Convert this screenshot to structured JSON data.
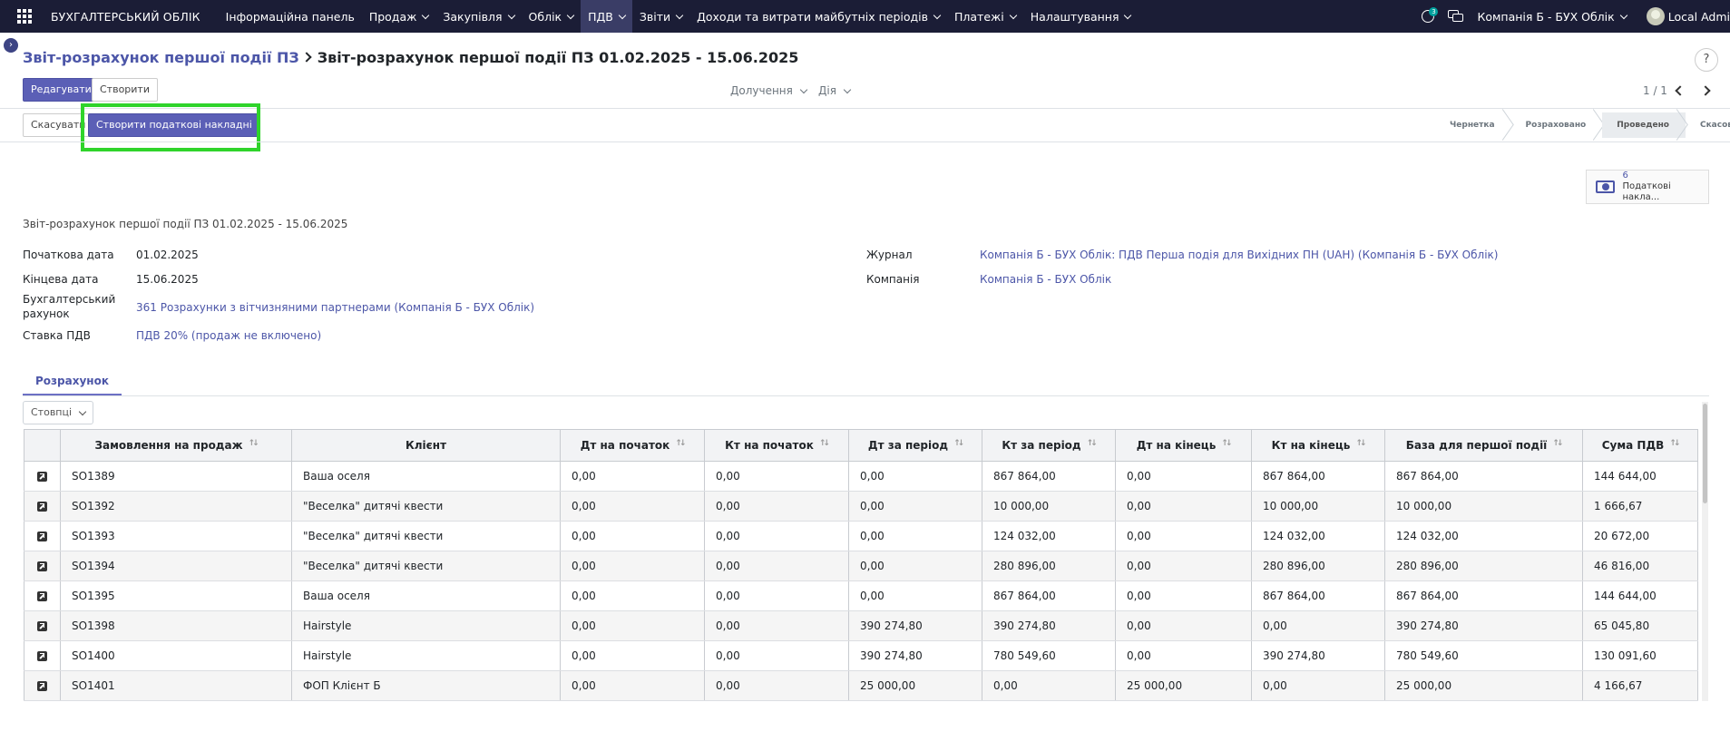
{
  "navbar": {
    "brand": "БУХГАЛТЕРСЬКИЙ ОБЛІК",
    "menu": [
      {
        "label": "Інформаційна панель",
        "dropdown": false,
        "active": false
      },
      {
        "label": "Продаж",
        "dropdown": true,
        "active": false
      },
      {
        "label": "Закупівля",
        "dropdown": true,
        "active": false
      },
      {
        "label": "Облік",
        "dropdown": true,
        "active": false
      },
      {
        "label": "ПДВ",
        "dropdown": true,
        "active": true
      },
      {
        "label": "Звіти",
        "dropdown": true,
        "active": false
      },
      {
        "label": "Доходи та витрати майбутніх періодів",
        "dropdown": true,
        "active": false
      },
      {
        "label": "Платежі",
        "dropdown": true,
        "active": false
      },
      {
        "label": "Налаштування",
        "dropdown": true,
        "active": false
      }
    ],
    "activity_badge": "3",
    "company": "Компанія Б - БУХ Облік",
    "user": "Local Admi"
  },
  "breadcrumb": {
    "parent": "Звіт-розрахунок першої події ПЗ",
    "current": "Звіт-розрахунок першої події ПЗ 01.02.2025 - 15.06.2025"
  },
  "help_label": "?",
  "control": {
    "edit_label": "Редагувати",
    "create_label": "Створити",
    "attachments_label": "Долучення",
    "action_label": "Дія",
    "pager": "1 / 1"
  },
  "statusbar": {
    "cancel_label": "Скасувати",
    "create_invoices_label": "Створити податкові накладні",
    "stages": [
      {
        "label": "Чернетка",
        "current": false
      },
      {
        "label": "Розраховано",
        "current": false
      },
      {
        "label": "Проведено",
        "current": true
      },
      {
        "label": "Скасовано",
        "current": false
      }
    ]
  },
  "smart_button": {
    "count": "6",
    "label": "Податкові накла..."
  },
  "form": {
    "title": "Звіт-розрахунок першої події ПЗ 01.02.2025 - 15.06.2025",
    "start_date_label": "Початкова дата",
    "start_date": "01.02.2025",
    "end_date_label": "Кінцева дата",
    "end_date": "15.06.2025",
    "account_label_1": "Бухгалтерський",
    "account_label_2": "рахунок",
    "account": "361 Розрахунки з вітчизняними партнерами (Компанія Б - БУХ Облік)",
    "vat_rate_label": "Ставка ПДВ",
    "vat_rate": "ПДВ 20% (продаж не включено)",
    "journal_label": "Журнал",
    "journal": "Компанія Б - БУХ Облік: ПДВ Перша подія для Вихідних ПН (UAH) (Компанія Б - БУХ Облік)",
    "company_label": "Компанія",
    "company": "Компанія Б - БУХ Облік"
  },
  "tab_label": "Розрахунок",
  "columns_button": "Стовпці",
  "table": {
    "headers": [
      "Замовлення на продаж",
      "Клієнт",
      "Дт на початок",
      "Кт на початок",
      "Дт за період",
      "Кт за період",
      "Дт на кінець",
      "Кт на кінець",
      "База для першої події",
      "Сума ПДВ"
    ],
    "rows": [
      [
        "SO1389",
        "Ваша оселя",
        "0,00",
        "0,00",
        "0,00",
        "867 864,00",
        "0,00",
        "867 864,00",
        "867 864,00",
        "144 644,00"
      ],
      [
        "SO1392",
        "\"Веселка\" дитячі квести",
        "0,00",
        "0,00",
        "0,00",
        "10 000,00",
        "0,00",
        "10 000,00",
        "10 000,00",
        "1 666,67"
      ],
      [
        "SO1393",
        "\"Веселка\" дитячі квести",
        "0,00",
        "0,00",
        "0,00",
        "124 032,00",
        "0,00",
        "124 032,00",
        "124 032,00",
        "20 672,00"
      ],
      [
        "SO1394",
        "\"Веселка\" дитячі квести",
        "0,00",
        "0,00",
        "0,00",
        "280 896,00",
        "0,00",
        "280 896,00",
        "280 896,00",
        "46 816,00"
      ],
      [
        "SO1395",
        "Ваша оселя",
        "0,00",
        "0,00",
        "0,00",
        "867 864,00",
        "0,00",
        "867 864,00",
        "867 864,00",
        "144 644,00"
      ],
      [
        "SO1398",
        "Hairstyle",
        "0,00",
        "0,00",
        "390 274,80",
        "390 274,80",
        "0,00",
        "0,00",
        "390 274,80",
        "65 045,80"
      ],
      [
        "SO1400",
        "Hairstyle",
        "0,00",
        "0,00",
        "390 274,80",
        "780 549,60",
        "0,00",
        "390 274,80",
        "780 549,60",
        "130 091,60"
      ],
      [
        "SO1401",
        "ФОП Клієнт Б",
        "0,00",
        "0,00",
        "25 000,00",
        "0,00",
        "25 000,00",
        "0,00",
        "25 000,00",
        "4 166,67"
      ]
    ]
  },
  "colors": {
    "navbar": "#1b1d36",
    "primary": "#5b5fb6",
    "link": "#4c56a8",
    "highlight": "#2fd42b"
  }
}
